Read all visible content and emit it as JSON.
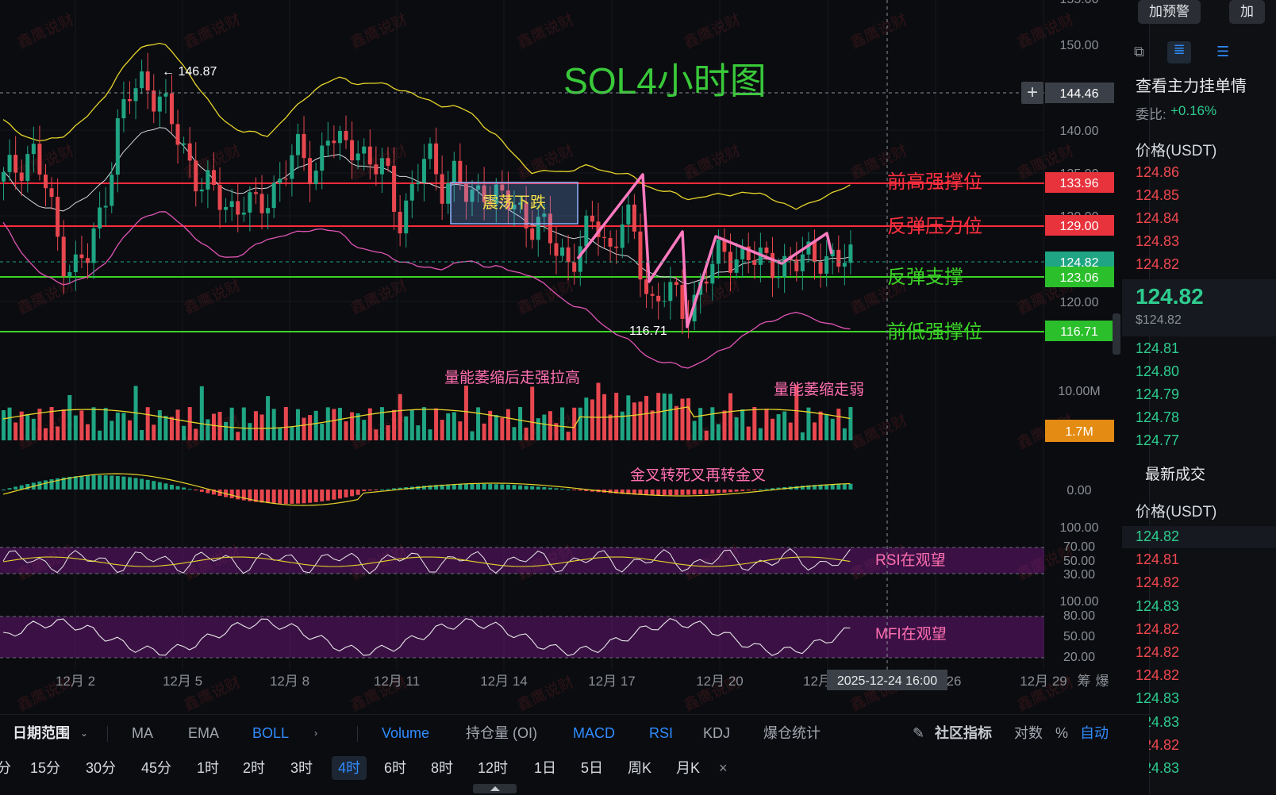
{
  "chart_data": {
    "type": "candlestick",
    "title": "SOL4小时图",
    "timeframe": "4时",
    "x_tick_labels": [
      "12月 2",
      "12月 5",
      "12月 8",
      "12月 11",
      "12月 14",
      "12月 17",
      "12月 20",
      "12月",
      "26",
      "12月 29"
    ],
    "crosshair_time": "2025-12-24 16:00",
    "y_tick_labels": [
      "155.00",
      "150.00",
      "140.00",
      "135.00",
      "130.00",
      "120.00"
    ],
    "volume_axis_label": "10.00M",
    "macd_axis_label": "0.00",
    "rsi_axis_labels": [
      "100.00",
      "70.00",
      "50.00",
      "30.00"
    ],
    "mfi_axis_labels": [
      "100.00",
      "80.00",
      "50.00",
      "20.00"
    ],
    "price_tags": [
      {
        "label": "144.46",
        "color": "#3b4048"
      },
      {
        "label": "133.96",
        "color": "#e8323c"
      },
      {
        "label": "129.00",
        "color": "#e8323c"
      },
      {
        "label": "124.82",
        "color": "#1fa583"
      },
      {
        "label": "123.06",
        "color": "#2bbf2b"
      },
      {
        "label": "116.71",
        "color": "#2bbf2b"
      }
    ],
    "volume_tag": "1.7M",
    "levels": [
      {
        "name": "前高强撑位",
        "value": 133.96,
        "color": "#ff2b3a"
      },
      {
        "name": "反弹压力位",
        "value": 129.0,
        "color": "#ff2b3a"
      },
      {
        "name": "反弹支撑",
        "value": 123.06,
        "color": "#3bd427"
      },
      {
        "name": "前低强撑位",
        "value": 116.71,
        "color": "#3bd427"
      }
    ],
    "annotations": {
      "high_marker": "← 146.87",
      "low_marker": "116.71",
      "range_box": "震荡下跌",
      "volume_note_1": "量能萎缩后走强拉高",
      "volume_note_2": "量能萎缩走弱",
      "macd_note": "金叉转死叉再转金叉",
      "rsi_note": "RSI在观望",
      "mfi_note": "MFI在观望"
    },
    "watermark": "鑫鹰说财",
    "ohlc_close_approx": [
      134,
      136,
      138,
      133,
      126,
      124,
      125,
      131,
      140,
      144,
      146,
      144,
      140,
      137,
      134,
      132,
      131,
      132,
      130,
      133,
      136,
      137,
      135,
      140,
      137,
      139,
      136,
      135,
      130,
      133,
      137,
      134,
      135,
      131,
      134,
      132,
      131,
      130,
      129,
      126,
      125,
      127,
      129,
      126,
      131,
      124,
      120,
      122,
      118,
      121,
      124,
      125,
      126,
      125,
      124,
      125,
      124,
      125,
      126,
      124,
      125
    ],
    "grid": true
  },
  "right_panel": {
    "btn_alert": "加预警",
    "btn_add": "加",
    "orders_title": "查看主力挂单情",
    "ratio_label": "委比:",
    "ratio_value": "+0.16%",
    "price_header": "价格(USDT)",
    "asks": [
      "124.86",
      "124.85",
      "124.84",
      "124.83",
      "124.82"
    ],
    "last_price": "124.82",
    "last_price_usd": "$124.82",
    "bids": [
      "124.81",
      "124.80",
      "124.79",
      "124.78",
      "124.77"
    ],
    "trades_title": "最新成交",
    "trades_header": "价格(USDT)",
    "trades": [
      {
        "price": "124.82",
        "side": "buy"
      },
      {
        "price": "124.81",
        "side": "sell"
      },
      {
        "price": "124.82",
        "side": "sell"
      },
      {
        "price": "124.83",
        "side": "buy"
      },
      {
        "price": "124.82",
        "side": "sell"
      },
      {
        "price": "124.82",
        "side": "sell"
      },
      {
        "price": "124.82",
        "side": "sell"
      },
      {
        "price": "124.83",
        "side": "buy"
      },
      {
        "price": "124.83",
        "side": "buy"
      },
      {
        "price": "124.82",
        "side": "sell"
      },
      {
        "price": "124.83",
        "side": "buy"
      }
    ]
  },
  "toolbar": {
    "date_range": "日期范围",
    "ma": "MA",
    "ema": "EMA",
    "boll": "BOLL",
    "volume": "Volume",
    "oi": "持仓量 (OI)",
    "macd": "MACD",
    "rsi": "RSI",
    "kdj": "KDJ",
    "liq": "爆仓统计",
    "community": "社区指标",
    "log": "对数",
    "pct": "%",
    "auto": "自动",
    "x_extra_1": "筹",
    "x_extra_2": "爆",
    "timeframes": [
      "分",
      "15分",
      "30分",
      "45分",
      "1时",
      "2时",
      "3时",
      "4时",
      "6时",
      "8时",
      "12时",
      "1日",
      "5日",
      "周K",
      "月K"
    ],
    "close_x": "×"
  }
}
